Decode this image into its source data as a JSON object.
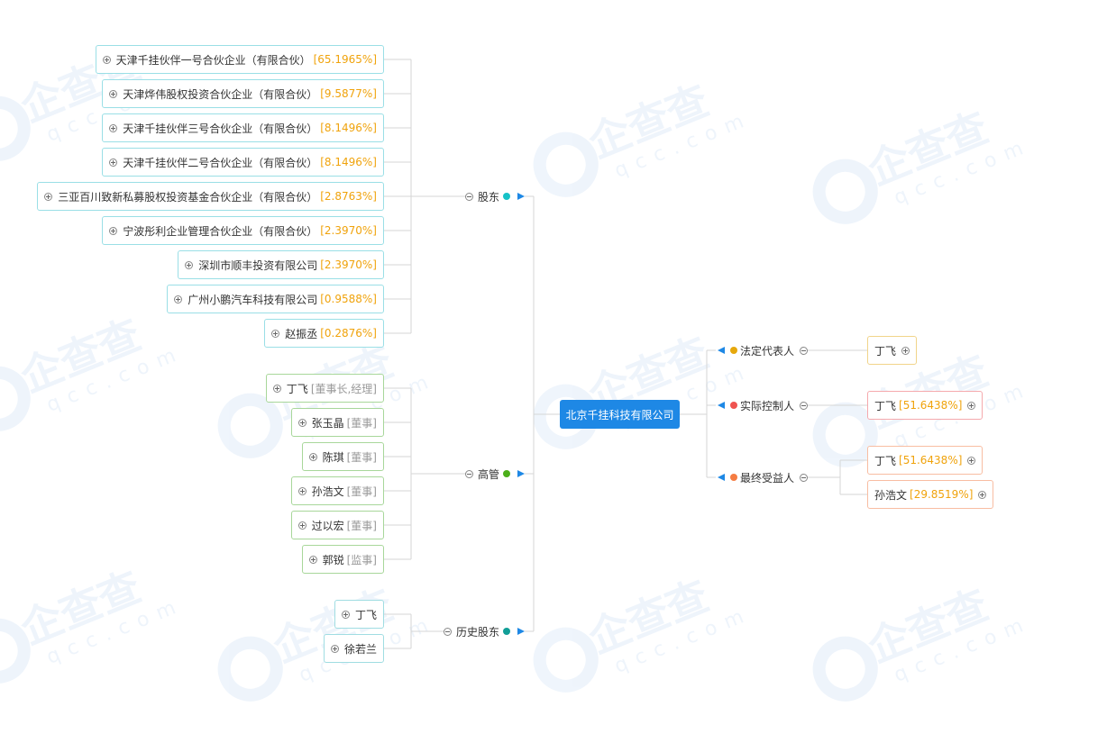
{
  "root": {
    "name": "北京千挂科技有限公司"
  },
  "watermark": {
    "brand": "企查查",
    "domain": "qcc.com"
  },
  "categories": {
    "shareholders": {
      "label": "股东",
      "color": "#17c2c7"
    },
    "executives": {
      "label": "高管",
      "color": "#4caf1a"
    },
    "history": {
      "label": "历史股东",
      "color": "#119e97"
    },
    "legal_rep": {
      "label": "法定代表人",
      "color": "#e6a80c"
    },
    "actual_controller": {
      "label": "实际控制人",
      "color": "#ef5350"
    },
    "ultimate_beneficiary": {
      "label": "最终受益人",
      "color": "#f57c42"
    }
  },
  "shareholders": [
    {
      "name": "天津千挂伙伴一号合伙企业（有限合伙）",
      "pct": "[65.1965%]"
    },
    {
      "name": "天津烨伟股权投资合伙企业（有限合伙）",
      "pct": "[9.5877%]"
    },
    {
      "name": "天津千挂伙伴三号合伙企业（有限合伙）",
      "pct": "[8.1496%]"
    },
    {
      "name": "天津千挂伙伴二号合伙企业（有限合伙）",
      "pct": "[8.1496%]"
    },
    {
      "name": "三亚百川致新私募股权投资基金合伙企业（有限合伙）",
      "pct": "[2.8763%]"
    },
    {
      "name": "宁波彤利企业管理合伙企业（有限合伙）",
      "pct": "[2.3970%]"
    },
    {
      "name": "深圳市顺丰投资有限公司",
      "pct": "[2.3970%]"
    },
    {
      "name": "广州小鹏汽车科技有限公司",
      "pct": "[0.9588%]"
    },
    {
      "name": "赵振丞",
      "pct": "[0.2876%]"
    }
  ],
  "executives": [
    {
      "name": "丁飞",
      "role": "[董事长,经理]"
    },
    {
      "name": "张玉晶",
      "role": "[董事]"
    },
    {
      "name": "陈琪",
      "role": "[董事]"
    },
    {
      "name": "孙浩文",
      "role": "[董事]"
    },
    {
      "name": "过以宏",
      "role": "[董事]"
    },
    {
      "name": "郭锐",
      "role": "[监事]"
    }
  ],
  "history": [
    {
      "name": "丁飞"
    },
    {
      "name": "徐若兰"
    }
  ],
  "legal_rep": [
    {
      "name": "丁飞"
    }
  ],
  "actual_controller": [
    {
      "name": "丁飞",
      "pct": "[51.6438%]"
    }
  ],
  "ultimate_beneficiary": [
    {
      "name": "丁飞",
      "pct": "[51.6438%]"
    },
    {
      "name": "孙浩文",
      "pct": "[29.8519%]"
    }
  ]
}
